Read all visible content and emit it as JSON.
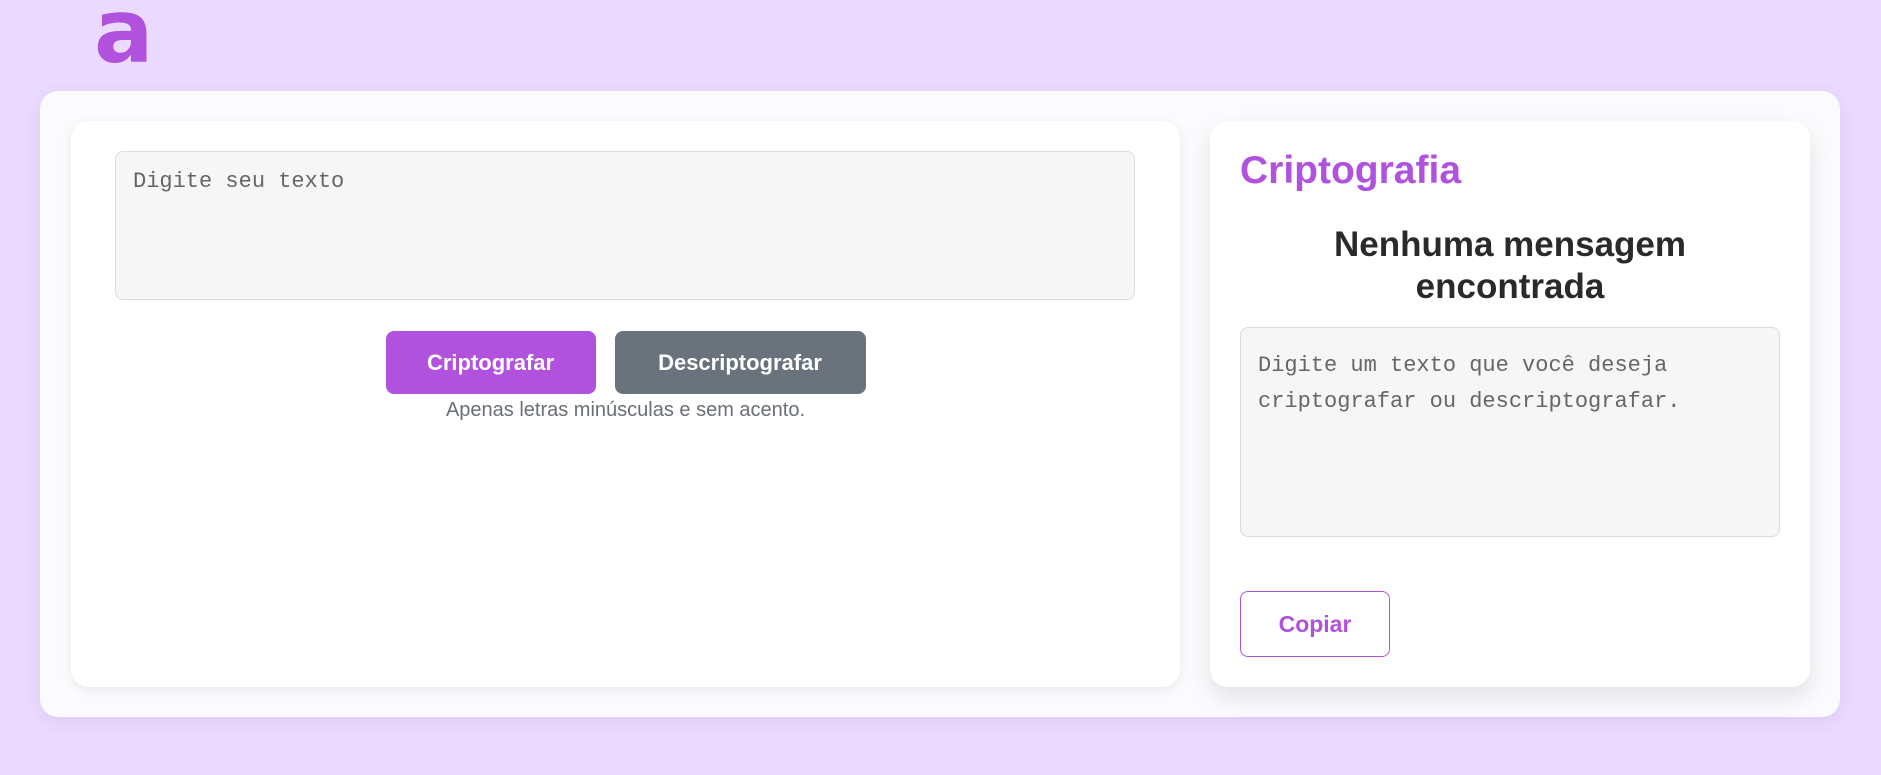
{
  "header": {
    "logo_text": "a"
  },
  "input": {
    "placeholder": "Digite seu texto",
    "value": ""
  },
  "actions": {
    "encrypt_label": "Criptografar",
    "decrypt_label": "Descriptografar",
    "hint": "Apenas letras minúsculas e sem acento."
  },
  "output": {
    "title": "Criptografia",
    "heading": "Nenhuma mensagem encontrada",
    "placeholder": "Digite um texto que você deseja criptografar ou descriptografar.",
    "value": "",
    "copy_label": "Copiar"
  },
  "colors": {
    "background": "#eadaff",
    "accent": "#b052de",
    "secondary_button": "#6a737c",
    "heading_text": "#2a2a2a"
  }
}
